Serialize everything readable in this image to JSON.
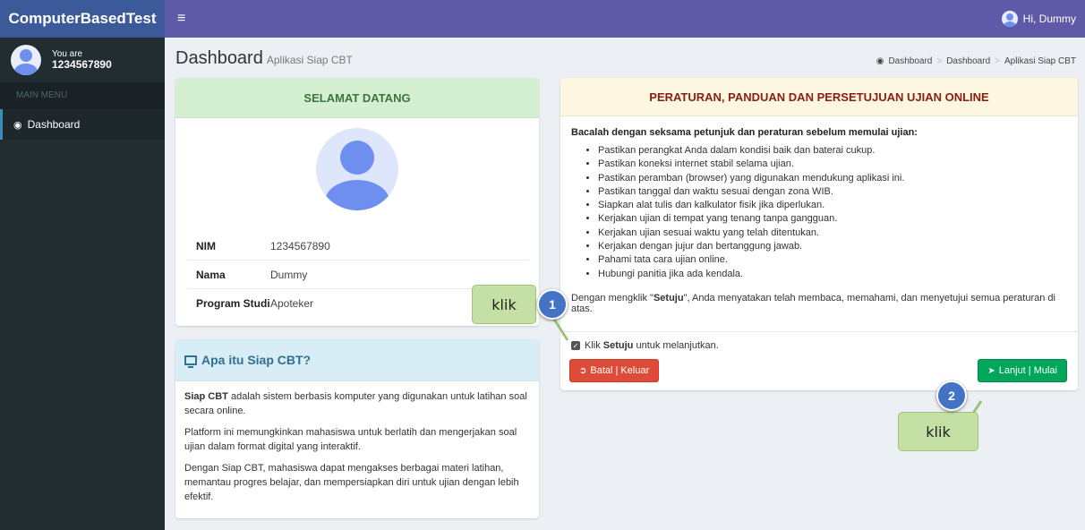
{
  "header": {
    "brand_prefix": "Computer ",
    "brand_bold": "Based",
    "brand_suffix": " Test",
    "menu_icon": "hamburger-icon",
    "user_greeting": "Hi, Dummy"
  },
  "sidebar": {
    "user_you_are": "You are",
    "user_nim": "1234567890",
    "menu_header": "MAIN MENU",
    "items": [
      {
        "label": "Dashboard",
        "icon": "dashboard-icon"
      }
    ]
  },
  "page": {
    "title": "Dashboard",
    "subtitle": "Aplikasi Siap CBT",
    "breadcrumb": [
      "Dashboard",
      "Dashboard",
      "Aplikasi Siap CBT"
    ]
  },
  "welcome": {
    "title": "SELAMAT DATANG",
    "fields": [
      {
        "label": "NIM",
        "value": "1234567890"
      },
      {
        "label": "Nama",
        "value": "Dummy"
      },
      {
        "label": "Program Studi",
        "value": "Apoteker"
      }
    ]
  },
  "about": {
    "title": "Apa itu Siap CBT?",
    "p1_bold": "Siap CBT",
    "p1_rest": " adalah sistem berbasis komputer yang digunakan untuk latihan soal secara online.",
    "p2": "Platform ini memungkinkan mahasiswa untuk berlatih dan mengerjakan soal ujian dalam format digital yang interaktif.",
    "p3": "Dengan Siap CBT, mahasiswa dapat mengakses berbagai materi latihan, memantau progres belajar, dan mempersiapkan diri untuk ujian dengan lebih efektif."
  },
  "rules": {
    "title": "PERATURAN, PANDUAN DAN PERSETUJUAN UJIAN ONLINE",
    "intro": "Bacalah dengan seksama petunjuk dan peraturan sebelum memulai ujian:",
    "items": [
      "Pastikan perangkat Anda dalam kondisi baik dan baterai cukup.",
      "Pastikan koneksi internet stabil selama ujian.",
      "Pastikan peramban (browser) yang digunakan mendukung aplikasi ini.",
      "Pastikan tanggal dan waktu sesuai dengan zona WIB.",
      "Siapkan alat tulis dan kalkulator fisik jika diperlukan.",
      "Kerjakan ujian di tempat yang tenang tanpa gangguan.",
      "Kerjakan ujian sesuai waktu yang telah ditentukan.",
      "Kerjakan dengan jujur dan bertanggung jawab.",
      "Pahami tata cara ujian online.",
      "Hubungi panitia jika ada kendala."
    ],
    "consent_pre": "Dengan mengklik \"",
    "consent_bold": "Setuju",
    "consent_post": "\", Anda menyatakan telah membaca, memahami, dan menyetujui semua peraturan di atas.",
    "agree_pre": "Klik ",
    "agree_bold": "Setuju",
    "agree_post": " untuk melanjutkan.",
    "agree_checked": true,
    "cancel_label": "Batal | Keluar",
    "next_label": "Lanjut | Mulai"
  },
  "annotations": {
    "callout_1": "klik",
    "badge_1": "1",
    "callout_2": "klik",
    "badge_2": "2"
  },
  "colors": {
    "topbar": "#5f5aa8",
    "brand": "#3c5a9a",
    "sidebar": "#222d32",
    "cancel": "#dd4b39",
    "next": "#00a65a",
    "callout": "#c5e0a4",
    "badge": "#4472c4"
  }
}
